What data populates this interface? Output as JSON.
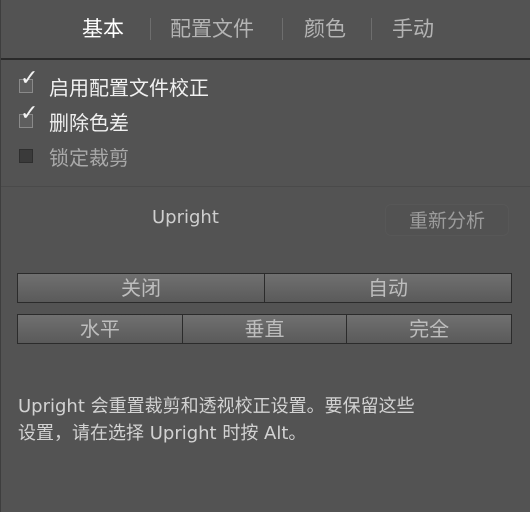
{
  "tabs": [
    {
      "label": "基本",
      "active": true
    },
    {
      "label": "配置文件",
      "active": false
    },
    {
      "label": "颜色",
      "active": false
    },
    {
      "label": "手动",
      "active": false
    }
  ],
  "checkboxes": [
    {
      "label": "启用配置文件校正",
      "checked": true
    },
    {
      "label": "删除色差",
      "checked": true
    },
    {
      "label": "锁定裁剪",
      "checked": false
    }
  ],
  "upright": {
    "label": "Upright",
    "reanalyze": "重新分析",
    "row1": [
      "关闭",
      "自动"
    ],
    "row2": [
      "水平",
      "垂直",
      "完全"
    ]
  },
  "info": {
    "line1": "Upright 会重置裁剪和透视校正设置。要保留这些",
    "line2": "设置，请在选择 Upright 时按 Alt。"
  },
  "colors": {
    "panel": "#535353",
    "active_tab": "#ffffff"
  }
}
